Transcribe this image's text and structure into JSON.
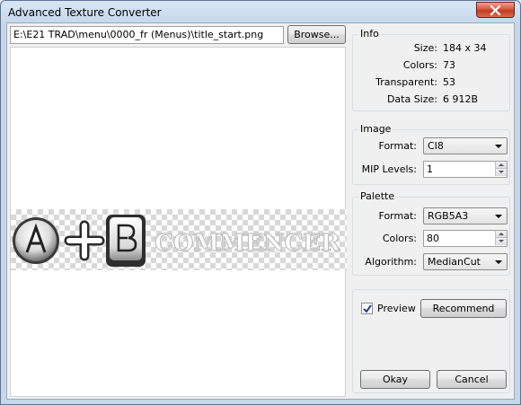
{
  "window": {
    "title": "Advanced Texture Converter"
  },
  "file": {
    "path": "E:\\E21 TRAD\\menu\\0000_fr (Menus)\\title_start.png",
    "browse_label": "Browse..."
  },
  "preview_texture": {
    "text": "COMMENCER"
  },
  "info": {
    "title": "Info",
    "rows": [
      {
        "label": "Size:",
        "value": "184 x 34"
      },
      {
        "label": "Colors:",
        "value": "73"
      },
      {
        "label": "Transparent:",
        "value": "53"
      },
      {
        "label": "Data Size:",
        "value": "6 912B"
      }
    ]
  },
  "image": {
    "title": "Image",
    "format_label": "Format:",
    "format_value": "CI8",
    "mip_label": "MIP Levels:",
    "mip_value": "1"
  },
  "palette": {
    "title": "Palette",
    "format_label": "Format:",
    "format_value": "RGB5A3",
    "colors_label": "Colors:",
    "colors_value": "80",
    "algorithm_label": "Algorithm:",
    "algorithm_value": "MedianCut"
  },
  "options": {
    "preview_label": "Preview",
    "preview_checked": true,
    "recommend_label": "Recommend",
    "okay_label": "Okay",
    "cancel_label": "Cancel"
  },
  "colors": {
    "titlebar": "#c4d6ea",
    "close_button": "#c23b1c",
    "dialog_bg": "#f0f0f0"
  }
}
